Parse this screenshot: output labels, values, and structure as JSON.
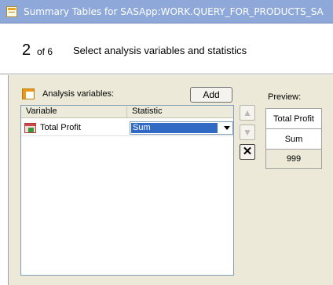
{
  "window": {
    "title": "Summary Tables for SASApp:WORK.QUERY_FOR_PRODUCTS_SA"
  },
  "header": {
    "step": "2",
    "of": "of 6",
    "title": "Select analysis variables and statistics"
  },
  "analysis": {
    "label": "Analysis variables:",
    "add_label": "Add",
    "columns": [
      "Variable",
      "Statistic"
    ],
    "rows": [
      {
        "variable": "Total Profit",
        "statistic": "Sum"
      }
    ]
  },
  "side_buttons": {
    "up": "▲",
    "down": "▼",
    "delete": "✕"
  },
  "preview": {
    "label": "Preview:",
    "header": "Total Profit",
    "stat": "Sum",
    "value": "999"
  }
}
